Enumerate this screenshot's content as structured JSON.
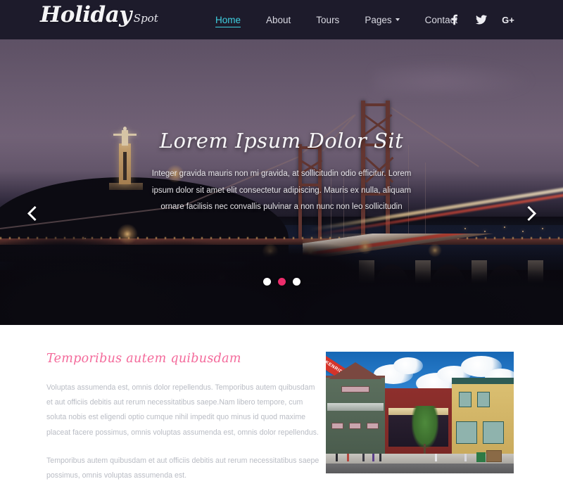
{
  "header": {
    "brand_main": "Holiday",
    "brand_sub": "Spot",
    "nav": [
      {
        "label": "Home",
        "active": true,
        "has_caret": false
      },
      {
        "label": "About",
        "active": false,
        "has_caret": false
      },
      {
        "label": "Tours",
        "active": false,
        "has_caret": false
      },
      {
        "label": "Pages",
        "active": false,
        "has_caret": true
      },
      {
        "label": "Contact",
        "active": false,
        "has_caret": false
      }
    ],
    "social": [
      {
        "name": "facebook-icon",
        "label": "f"
      },
      {
        "name": "twitter-icon",
        "label": ""
      },
      {
        "name": "google-plus-icon",
        "label": "G+"
      }
    ],
    "accent_active": "#3fd0e0",
    "background": "#1d1b2b"
  },
  "hero": {
    "title": "Lorem Ipsum Dolor Sit",
    "description": "Integer gravida mauris non mi gravida, at sollicitudin odio efficitur. Lorem ipsum dolor sit amet elit consectetur adipiscing. Mauris ex nulla, aliquam ornare facilisis nec convallis pulvinar a non nunc non leo sollicitudin",
    "prev_label": "‹",
    "next_label": "›",
    "dots": [
      {
        "active": false
      },
      {
        "active": true
      },
      {
        "active": false
      }
    ],
    "dot_active_color": "#ec2d6b"
  },
  "content": {
    "section_title": "Temporibus autem quibusdam",
    "title_color": "#f46a9b",
    "paragraphs": [
      "Voluptas assumenda est, omnis dolor repellendus. Temporibus autem quibusdam et aut officiis debitis aut rerum necessitatibus saepe.Nam libero tempore, cum soluta nobis est eligendi optio cumque nihil impedit quo minus id quod maxime placeat facere possimus, omnis voluptas assumenda est, omnis dolor repellendus.",
      "Temporibus autem quibusdam et aut officiis debitis aut rerum necessitatibus saepe possimus, omnis voluptas assumenda est."
    ],
    "image_banner_text": "CKENRIDGE MUSEUM"
  }
}
